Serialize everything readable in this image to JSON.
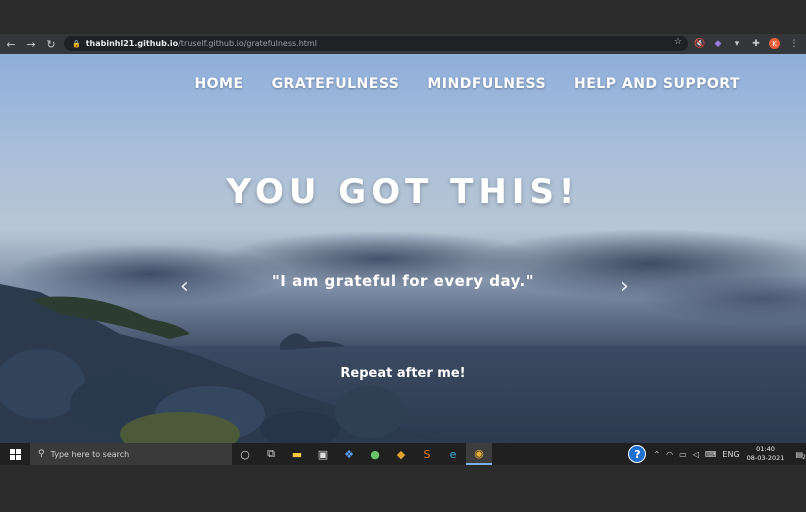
{
  "browser": {
    "url_host": "thabinhl21.github.io",
    "url_path": "/truself.github.io/gratefulness.html",
    "avatar_letter": "K"
  },
  "site": {
    "nav": [
      "HOME",
      "GRATEFULNESS",
      "MINDFULNESS",
      "HELP AND SUPPORT"
    ],
    "headline": "YOU GOT THIS!",
    "quote": "\"I am grateful for every day.\"",
    "repeat": "Repeat after me!",
    "prev_arrow": "‹",
    "next_arrow": "›"
  },
  "taskbar": {
    "search_placeholder": "Type here to search",
    "language": "ENG",
    "time": "01:40",
    "date": "08-03-2021",
    "notification_count": "2"
  }
}
